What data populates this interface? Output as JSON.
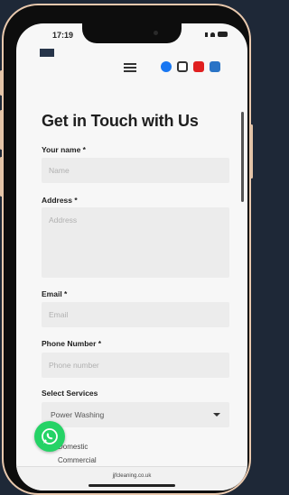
{
  "status": {
    "time": "17:19"
  },
  "header": {
    "logo_text": "",
    "menu_icon": "hamburger-icon",
    "social_icons": [
      "facebook-icon",
      "instagram-icon",
      "youtube-icon",
      "linkedin-icon"
    ]
  },
  "form": {
    "title": "Get in Touch with Us",
    "name": {
      "label": "Your name *",
      "placeholder": "Name"
    },
    "address": {
      "label": "Address *",
      "placeholder": "Address"
    },
    "email": {
      "label": "Email *",
      "placeholder": "Email"
    },
    "phone": {
      "label": "Phone Number *",
      "placeholder": "Phone number"
    },
    "services": {
      "label": "Select Services",
      "selected": "Power Washing",
      "options_visible": [
        "Domestic",
        "Commercial"
      ]
    }
  },
  "browser": {
    "url": "jjfcleaning.co.uk"
  },
  "colors": {
    "background": "#1e2837",
    "phone_frame": "#e9c9ae",
    "whatsapp": "#25d366",
    "facebook": "#1877f2",
    "youtube": "#e02020",
    "linkedin": "#2a74c6"
  }
}
